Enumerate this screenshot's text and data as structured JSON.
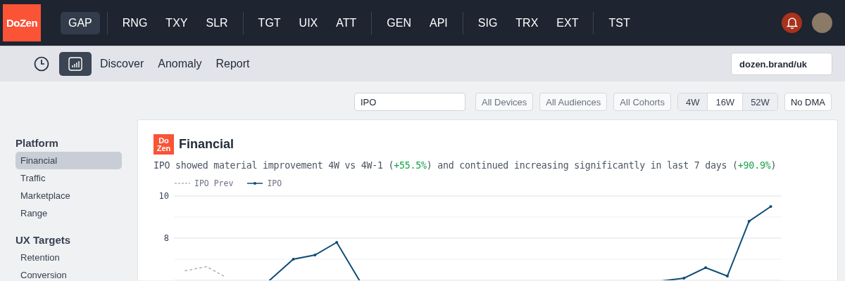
{
  "topbar": {
    "logo": "DoZen",
    "groups": [
      {
        "items": [
          {
            "label": "GAP",
            "selected": true
          }
        ]
      },
      {
        "items": [
          {
            "label": "RNG",
            "selected": false
          },
          {
            "label": "TXY",
            "selected": false
          },
          {
            "label": "SLR",
            "selected": false
          }
        ]
      },
      {
        "items": [
          {
            "label": "TGT",
            "selected": false
          },
          {
            "label": "UIX",
            "selected": false
          },
          {
            "label": "ATT",
            "selected": false
          }
        ]
      },
      {
        "items": [
          {
            "label": "GEN",
            "selected": false
          },
          {
            "label": "API",
            "selected": false
          }
        ]
      },
      {
        "items": [
          {
            "label": "SIG",
            "selected": false
          },
          {
            "label": "TRX",
            "selected": false
          },
          {
            "label": "EXT",
            "selected": false
          }
        ]
      },
      {
        "items": [
          {
            "label": "TST",
            "selected": false
          }
        ]
      }
    ]
  },
  "subnav": {
    "icons": [
      {
        "kind": "clock",
        "selected": false
      },
      {
        "kind": "chart",
        "selected": true
      }
    ],
    "links": [
      "Discover",
      "Anomaly",
      "Report"
    ],
    "site": {
      "value": "dozen.brand/uk"
    }
  },
  "filters": {
    "search": {
      "value": "IPO"
    },
    "dropdowns": [
      "All Devices",
      "All Audiences",
      "All Cohorts"
    ],
    "periods": [
      {
        "label": "4W",
        "selected": false
      },
      {
        "label": "16W",
        "selected": true
      },
      {
        "label": "52W",
        "selected": false
      }
    ],
    "dma": "No DMA"
  },
  "sidebar": {
    "sections": [
      {
        "title": "Platform",
        "items": [
          {
            "label": "Financial",
            "selected": true
          },
          {
            "label": "Traffic",
            "selected": false
          },
          {
            "label": "Marketplace",
            "selected": false
          },
          {
            "label": "Range",
            "selected": false
          }
        ]
      },
      {
        "title": "UX Targets",
        "items": [
          {
            "label": "Retention",
            "selected": false
          },
          {
            "label": "Conversion",
            "selected": false
          }
        ]
      }
    ]
  },
  "card": {
    "logo": [
      "Do",
      "Zen"
    ],
    "title": "Financial",
    "insight": [
      {
        "kind": "plain",
        "text": "IPO showed material improvement 4W vs 4W-1 ("
      },
      {
        "kind": "positive",
        "text": "+55.5%"
      },
      {
        "kind": "plain",
        "text": ") and continued increasing significantly in last 7 days ("
      },
      {
        "kind": "positive",
        "text": "+90.9%"
      },
      {
        "kind": "plain",
        "text": ")"
      }
    ],
    "chart": {
      "legend": [
        {
          "kind": "previous",
          "name": "IPO Prev"
        },
        {
          "kind": "current",
          "name": "IPO"
        }
      ],
      "y_labels": [
        "10",
        "8"
      ]
    }
  }
}
